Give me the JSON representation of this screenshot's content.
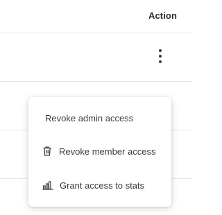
{
  "table": {
    "header": {
      "action_label": "Action"
    }
  },
  "menu": {
    "items": [
      {
        "label": "Revoke admin access",
        "icon": ""
      },
      {
        "label": "Revoke member access",
        "icon": "trash-icon"
      },
      {
        "label": "Grant access to stats",
        "icon": "bar-chart-icon"
      }
    ]
  },
  "colors": {
    "text_primary": "#2b2b2b",
    "menu_text": "#3b3b3b",
    "divider": "#e6e6e6",
    "menu_background": "#ffffff"
  }
}
